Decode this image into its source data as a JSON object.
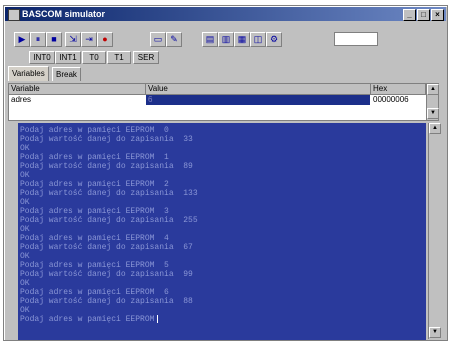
{
  "window": {
    "title": "BASCOM simulator",
    "controls": [
      "_",
      "□",
      "×"
    ]
  },
  "toolbar": {
    "tools": [
      {
        "name": "run-icon",
        "glyph": "▶"
      },
      {
        "name": "pause-icon",
        "glyph": "⏸"
      },
      {
        "name": "stop-icon",
        "glyph": "■"
      },
      {
        "name": "step-into-icon",
        "glyph": "⇲"
      },
      {
        "name": "step-over-icon",
        "glyph": "⇥"
      },
      {
        "name": "breakpoint-icon",
        "glyph": "●"
      },
      {
        "name": "monitor-icon",
        "glyph": "▭"
      },
      {
        "name": "pencil-icon",
        "glyph": "✎"
      },
      {
        "name": "lcd-icon",
        "glyph": "▤"
      },
      {
        "name": "terminal-icon",
        "glyph": "▥"
      },
      {
        "name": "memory-icon",
        "glyph": "▦"
      },
      {
        "name": "port-icon",
        "glyph": "◫"
      },
      {
        "name": "settings-icon",
        "glyph": "⚙"
      }
    ],
    "buttons": [
      "INT0",
      "INT1",
      "T0",
      "T1",
      "SER"
    ],
    "input_value": ""
  },
  "tabs": [
    "Variables",
    "Break"
  ],
  "variables": {
    "columns": [
      "Variable",
      "Value",
      "Hex"
    ],
    "rows": [
      {
        "variable": "adres",
        "value": "6",
        "hex": "00000006"
      }
    ]
  },
  "terminal": {
    "lines": [
      "Podaj adres w pamięci EEPROM  0",
      "Podaj wartość danej do zapisania  33",
      "OK",
      "Podaj adres w pamięci EEPROM  1",
      "Podaj wartość danej do zapisania  89",
      "OK",
      "Podaj adres w pamięci EEPROM  2",
      "Podaj wartość danej do zapisania  133",
      "OK",
      "Podaj adres w pamięci EEPROM  3",
      "Podaj wartość danej do zapisania  255",
      "OK",
      "Podaj adres w pamięci EEPROM  4",
      "Podaj wartość danej do zapisania  67",
      "OK",
      "Podaj adres w pamięci EEPROM  5",
      "Podaj wartość danej do zapisania  99",
      "OK",
      "Podaj adres w pamięci EEPROM  6",
      "Podaj wartość danej do zapisania  88",
      "OK",
      "Podaj adres w pamięci EEPROM"
    ]
  },
  "colors": {
    "titlebar": "#0a246a",
    "terminal_bg": "#2a3a9c",
    "terminal_text": "#8a96d6",
    "selection": "#1c2f8a"
  }
}
